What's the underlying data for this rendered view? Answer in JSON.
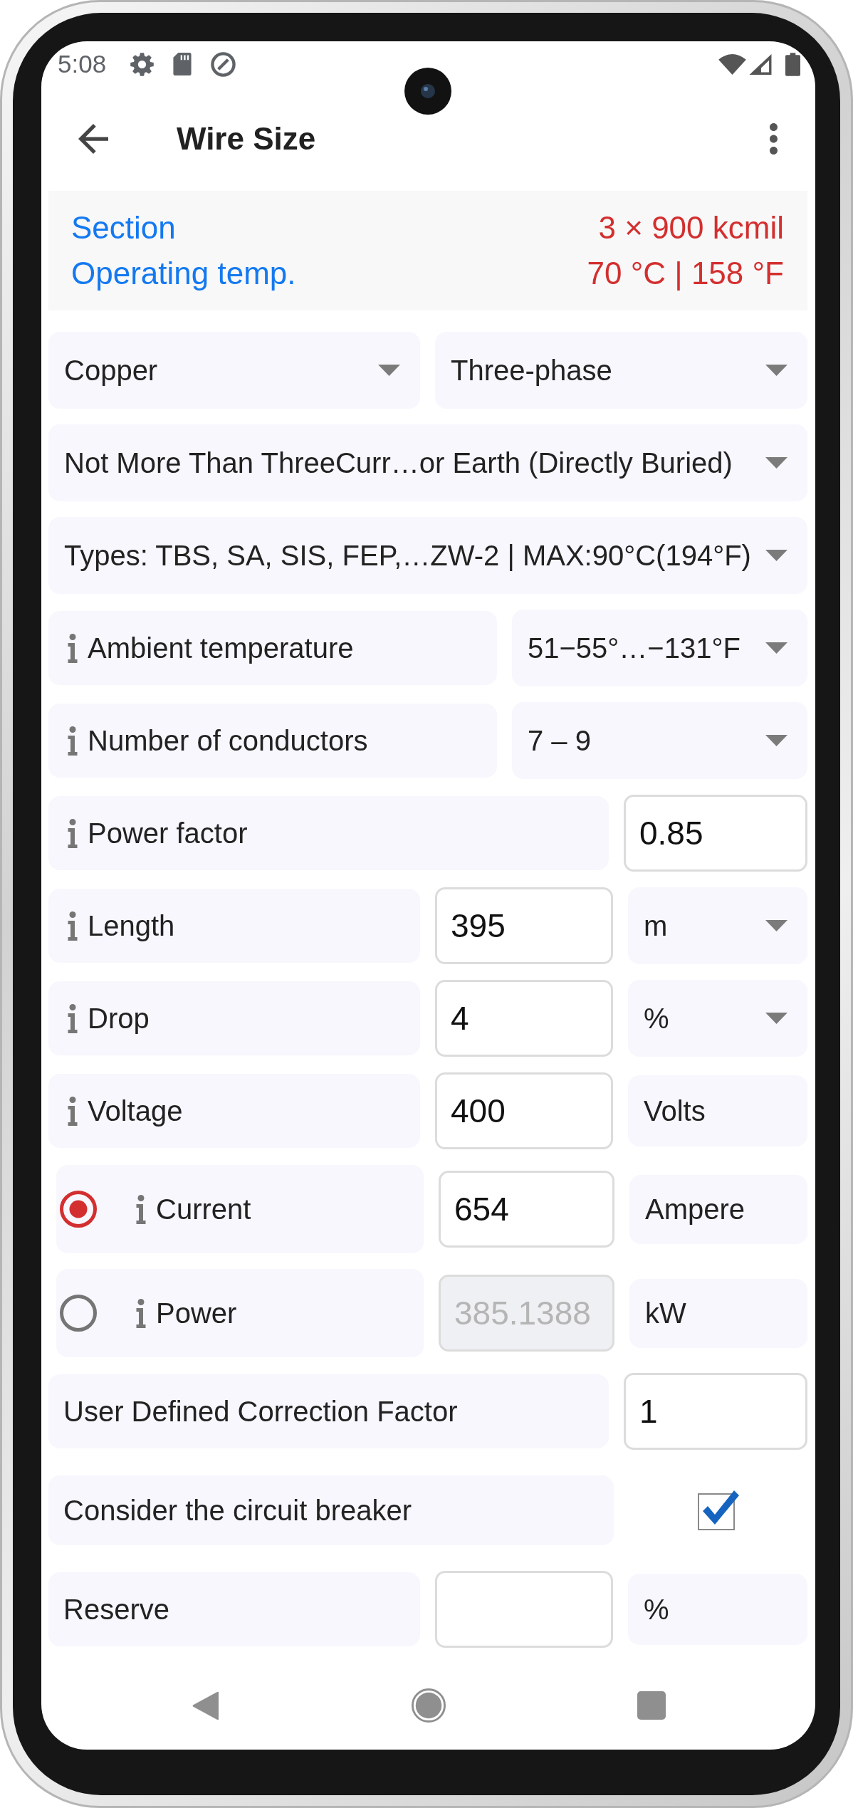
{
  "status_bar": {
    "time": "5:08"
  },
  "app_bar": {
    "title": "Wire Size"
  },
  "summary": [
    {
      "label": "Section",
      "value": "3 × 900 kcmil"
    },
    {
      "label": "Operating temp.",
      "value": "70 °C | 158 °F"
    }
  ],
  "rows": [
    {
      "kind": "pair",
      "cells": [
        {
          "kind": "dropdown",
          "value": "Copper"
        },
        {
          "kind": "dropdown",
          "value": "Three-phase"
        }
      ]
    },
    {
      "kind": "wide",
      "cells": [
        {
          "kind": "dropdown",
          "value": "Not More Than ThreeCurr…or Earth (Directly Buried)"
        }
      ]
    },
    {
      "kind": "wide",
      "cells": [
        {
          "kind": "dropdown",
          "value": "Types: TBS, SA, SIS, FEP,…ZW-2 | MAX:90°C(194°F)"
        }
      ]
    },
    {
      "kind": "option",
      "cells": [
        {
          "kind": "label",
          "text": "Ambient temperature",
          "info": true
        },
        {
          "kind": "dropdown",
          "value": "51−55°…−131°F"
        }
      ]
    },
    {
      "kind": "option",
      "cells": [
        {
          "kind": "label",
          "text": "Number of conductors",
          "info": true
        },
        {
          "kind": "dropdown",
          "value": "7 – 9"
        }
      ]
    },
    {
      "kind": "entry",
      "cells": [
        {
          "kind": "label",
          "text": "Power factor",
          "info": true
        },
        {
          "kind": "input",
          "value": "0.85",
          "disabled": false
        }
      ]
    },
    {
      "kind": "quantity",
      "cells": [
        {
          "kind": "label",
          "text": "Length",
          "info": true
        },
        {
          "kind": "input",
          "value": "395",
          "disabled": false
        },
        {
          "kind": "dropdown",
          "value": "m"
        }
      ]
    },
    {
      "kind": "quantity",
      "cells": [
        {
          "kind": "label",
          "text": "Drop",
          "info": true
        },
        {
          "kind": "input",
          "value": "4",
          "disabled": false
        },
        {
          "kind": "dropdown",
          "value": "%"
        }
      ]
    },
    {
      "kind": "quantity",
      "cells": [
        {
          "kind": "label",
          "text": "Voltage",
          "info": true
        },
        {
          "kind": "input",
          "value": "400",
          "disabled": false
        },
        {
          "kind": "unit",
          "text": "Volts"
        }
      ]
    },
    {
      "kind": "choice",
      "selected": true,
      "cells": [
        {
          "kind": "label",
          "text": "Current",
          "info": true
        },
        {
          "kind": "input",
          "value": "654",
          "disabled": false
        },
        {
          "kind": "unit",
          "text": "Ampere"
        }
      ]
    },
    {
      "kind": "choice",
      "selected": false,
      "cells": [
        {
          "kind": "label",
          "text": "Power",
          "info": true
        },
        {
          "kind": "input",
          "value": "385.1388",
          "disabled": true
        },
        {
          "kind": "unit",
          "text": "kW"
        }
      ]
    },
    {
      "kind": "entry",
      "cells": [
        {
          "kind": "label",
          "text": "User Defined Correction Factor",
          "info": false
        },
        {
          "kind": "input",
          "value": "1",
          "disabled": false
        }
      ]
    },
    {
      "kind": "toggle",
      "cells": [
        {
          "kind": "label",
          "text": "Consider the circuit breaker",
          "info": false
        },
        {
          "kind": "checkbox",
          "checked": true
        }
      ]
    },
    {
      "kind": "quantity",
      "cells": [
        {
          "kind": "label",
          "text": "Reserve",
          "info": false
        },
        {
          "kind": "input",
          "disabled": false
        },
        {
          "kind": "unit",
          "text": "%"
        }
      ]
    }
  ]
}
